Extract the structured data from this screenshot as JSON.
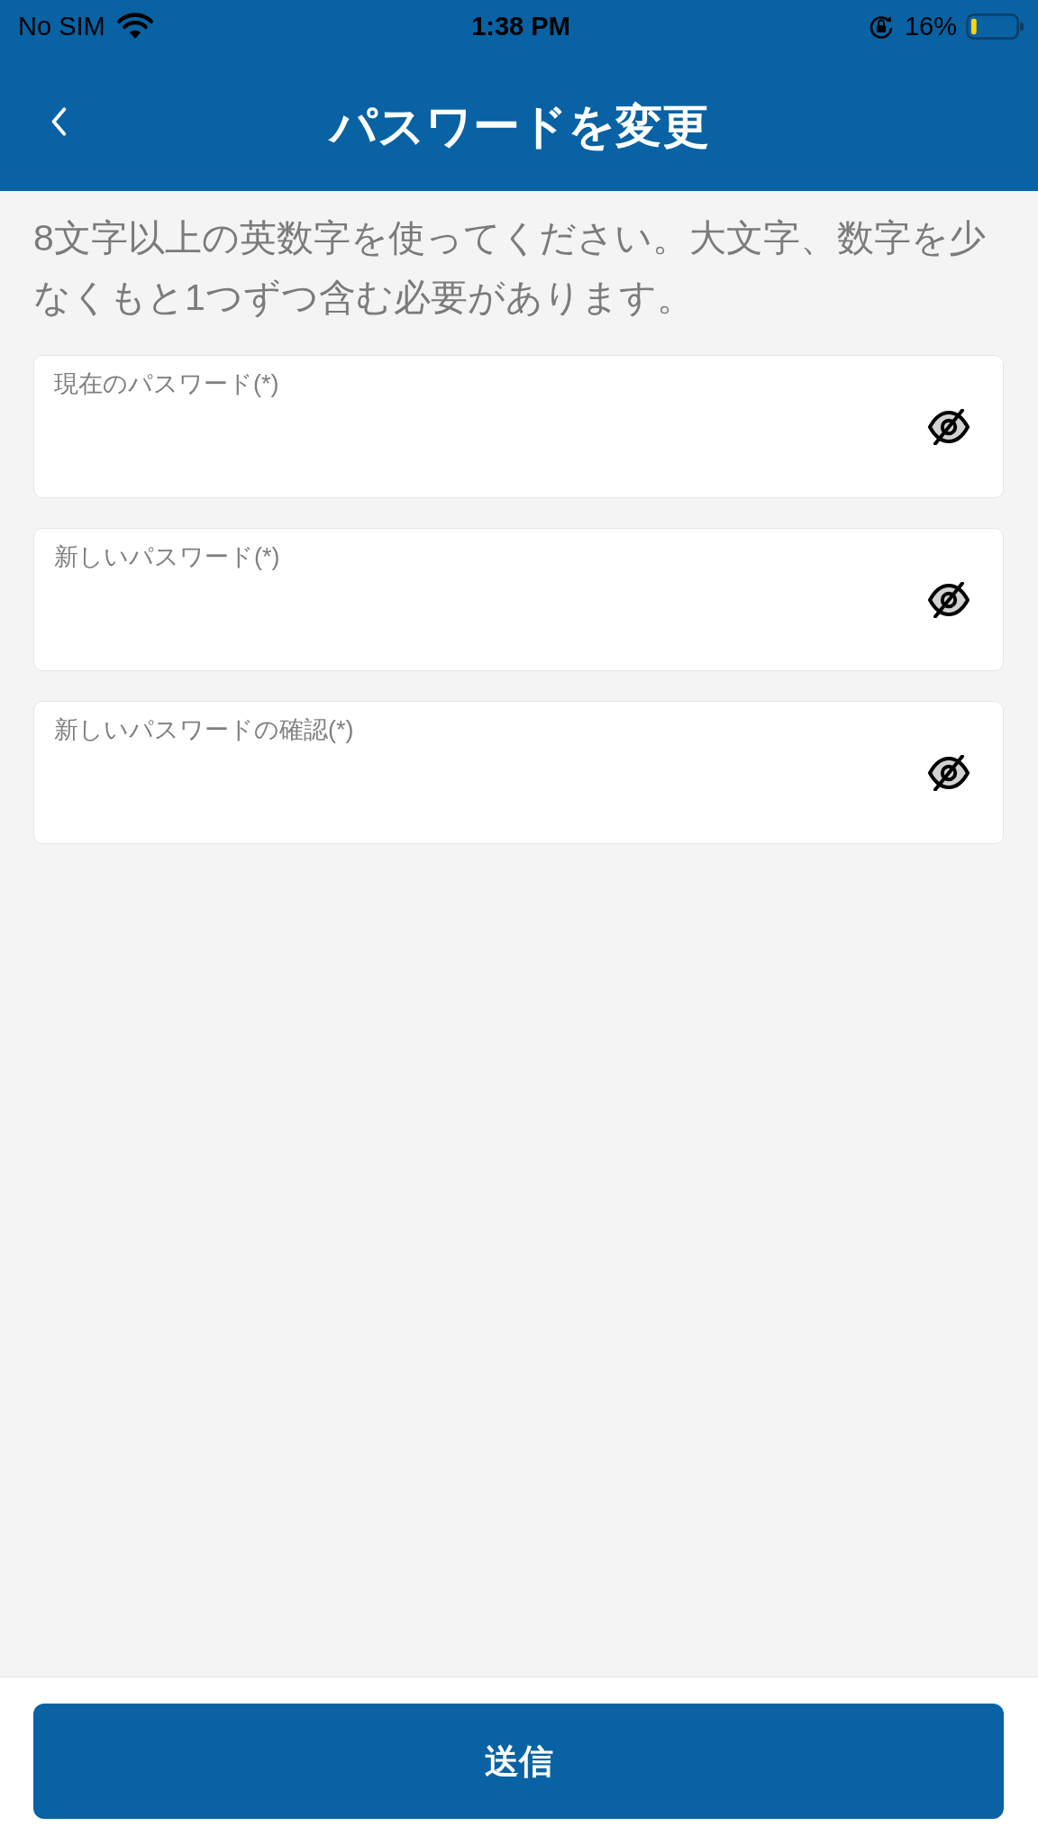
{
  "status_bar": {
    "carrier": "No SIM",
    "time": "1:38 PM",
    "battery_percent": "16%"
  },
  "header": {
    "title": "パスワードを変更"
  },
  "instructions": "8文字以上の英数字を使ってください。大文字、数字を少なくもと1つずつ含む必要があります。",
  "fields": [
    {
      "label": "現在のパスワード(*)",
      "visible": false
    },
    {
      "label": "新しいパスワード(*)",
      "visible": false
    },
    {
      "label": "新しいパスワードの確認(*)",
      "visible": false
    }
  ],
  "submit_button": {
    "label": "送信"
  }
}
